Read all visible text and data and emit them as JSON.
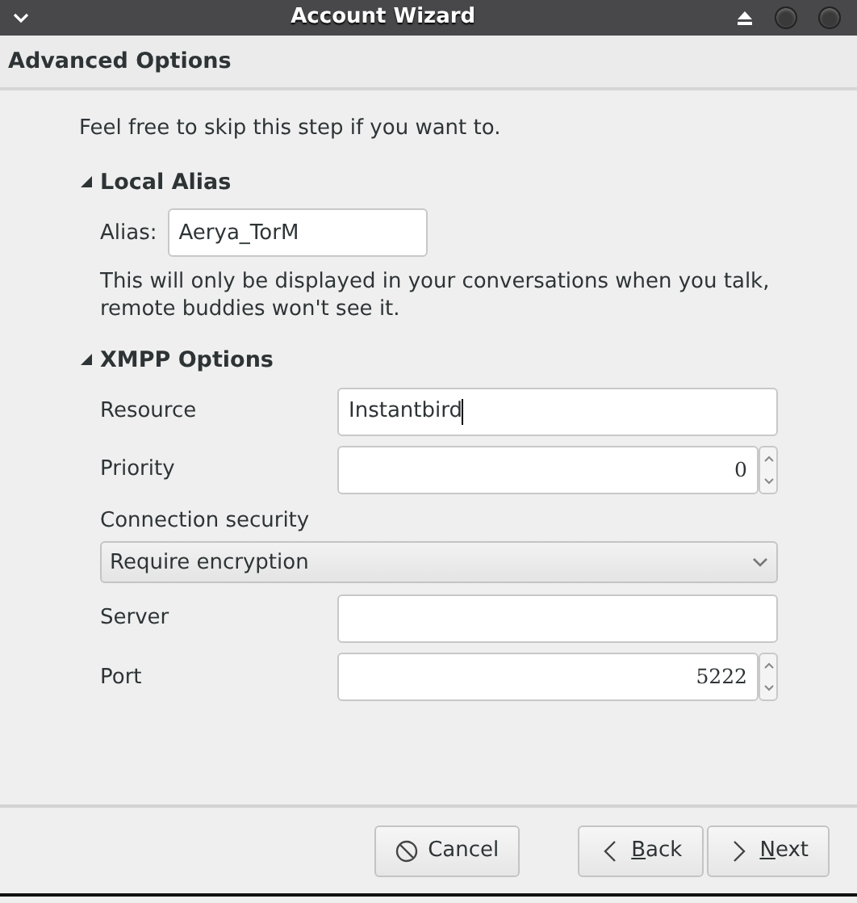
{
  "window": {
    "title": "Account Wizard"
  },
  "page_title": "Advanced Options",
  "intro": "Feel free to skip this step if you want to.",
  "sections": [
    {
      "title": "Local Alias",
      "expanded": true,
      "fields": [
        {
          "kind": "inline",
          "label": "Alias:",
          "value": "Aerya_TorM"
        }
      ],
      "note": "This will only be displayed in your conversations when you talk, remote buddies won't see it."
    },
    {
      "title": "XMPP Options",
      "expanded": true,
      "fields": [
        {
          "kind": "text",
          "label": "Resource",
          "value": "Instantbird"
        },
        {
          "kind": "number",
          "label": "Priority",
          "value": "0"
        },
        {
          "kind": "select",
          "label": "Connection security",
          "value": "Require encryption"
        },
        {
          "kind": "text",
          "label": "Server"
        },
        {
          "kind": "number",
          "label": "Port",
          "value": "5222"
        }
      ]
    }
  ],
  "buttons": [
    {
      "kind": "cancel",
      "label": "Cancel"
    },
    {
      "kind": "back",
      "label": "Back",
      "mnemonic": true
    },
    {
      "kind": "next",
      "label": "Next",
      "mnemonic": true
    }
  ]
}
